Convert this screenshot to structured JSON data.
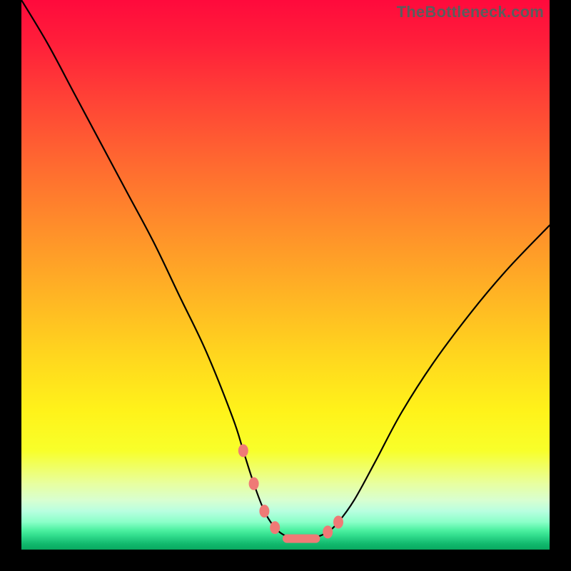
{
  "watermark": "TheBottleneck.com",
  "chart_data": {
    "type": "line",
    "title": "",
    "xlabel": "",
    "ylabel": "",
    "xlim": [
      0,
      100
    ],
    "ylim": [
      0,
      100
    ],
    "series": [
      {
        "name": "bottleneck-curve",
        "x": [
          0,
          5,
          10,
          15,
          20,
          25,
          30,
          35,
          40,
          42,
          44,
          46,
          48,
          50,
          52,
          54,
          55,
          56,
          58,
          60,
          63,
          67,
          72,
          78,
          85,
          92,
          100
        ],
        "values": [
          100,
          92,
          83,
          74,
          65,
          56,
          46,
          36,
          24,
          18,
          12,
          7,
          4,
          2.5,
          2,
          2,
          2,
          2.3,
          3.2,
          5,
          9,
          16,
          25,
          34,
          43,
          51,
          59
        ]
      }
    ],
    "markers": {
      "name": "highlight-points",
      "color": "#ef7a76",
      "x": [
        42,
        44,
        46,
        48,
        50,
        52,
        54,
        56,
        58,
        60
      ],
      "values": [
        18,
        12,
        7,
        4,
        2.5,
        2,
        2,
        2.3,
        3.2,
        5
      ]
    },
    "gradient_stops": [
      {
        "pos": 0,
        "color": "#ff0a3c"
      },
      {
        "pos": 18,
        "color": "#ff4236"
      },
      {
        "pos": 42,
        "color": "#ff902a"
      },
      {
        "pos": 65,
        "color": "#ffd71e"
      },
      {
        "pos": 82,
        "color": "#f8ff2a"
      },
      {
        "pos": 93,
        "color": "#b8ffe0"
      },
      {
        "pos": 100,
        "color": "#0aa860"
      }
    ]
  }
}
